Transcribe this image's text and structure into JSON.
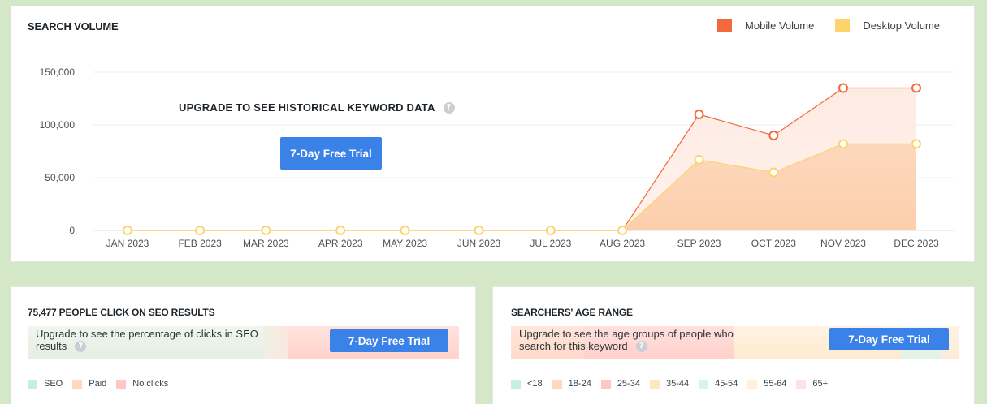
{
  "search_volume": {
    "title": "SEARCH VOLUME",
    "upgrade_message": "UPGRADE TO SEE HISTORICAL KEYWORD DATA",
    "trial_button": "7-Day Free Trial",
    "legend": [
      {
        "name": "Mobile Volume",
        "color": "#f06a3c"
      },
      {
        "name": "Desktop Volume",
        "color": "#ffd36b"
      }
    ]
  },
  "chart_data": {
    "type": "area",
    "title": "SEARCH VOLUME",
    "categories": [
      "JAN 2023",
      "FEB 2023",
      "MAR 2023",
      "APR 2023",
      "MAY 2023",
      "JUN 2023",
      "JUL 2023",
      "AUG 2023",
      "SEP 2023",
      "OCT 2023",
      "NOV 2023",
      "DEC 2023"
    ],
    "series": [
      {
        "name": "Mobile Volume",
        "color": "#f06a3c",
        "values": [
          0,
          0,
          0,
          0,
          0,
          0,
          0,
          0,
          110000,
          90000,
          135000,
          135000
        ]
      },
      {
        "name": "Desktop Volume",
        "color": "#ffd36b",
        "values": [
          0,
          0,
          0,
          0,
          0,
          0,
          0,
          0,
          67000,
          55000,
          82000,
          82000
        ]
      }
    ],
    "yticks": [
      "150,000",
      "100,000",
      "50,000",
      "0"
    ],
    "ytick_values": [
      150000,
      100000,
      50000,
      0
    ],
    "ylim": [
      0,
      150000
    ],
    "grid": true,
    "legend_position": "top-right"
  },
  "seo_clicks": {
    "title": "75,477 PEOPLE CLICK ON SEO RESULTS",
    "message_line1": "Upgrade to see the percentage of clicks in SEO",
    "message_line2": "results",
    "trial_button": "7-Day Free Trial",
    "legend": [
      {
        "name": "SEO",
        "color": "#c5f0dc"
      },
      {
        "name": "Paid",
        "color": "#ffd9bf"
      },
      {
        "name": "No clicks",
        "color": "#ffc6c6"
      }
    ]
  },
  "age_range": {
    "title": "SEARCHERS' AGE RANGE",
    "message_line1": "Upgrade to see the age groups of people who",
    "message_line2": "search for this keyword",
    "trial_button": "7-Day Free Trial",
    "legend": [
      {
        "name": "<18",
        "color": "#c5f0dc"
      },
      {
        "name": "18-24",
        "color": "#ffd9bf"
      },
      {
        "name": "25-34",
        "color": "#ffc6c6"
      },
      {
        "name": "35-44",
        "color": "#fde8c2"
      },
      {
        "name": "45-54",
        "color": "#d9f5e7"
      },
      {
        "name": "55-64",
        "color": "#fff1dc"
      },
      {
        "name": "65+",
        "color": "#fde3e3"
      }
    ]
  }
}
